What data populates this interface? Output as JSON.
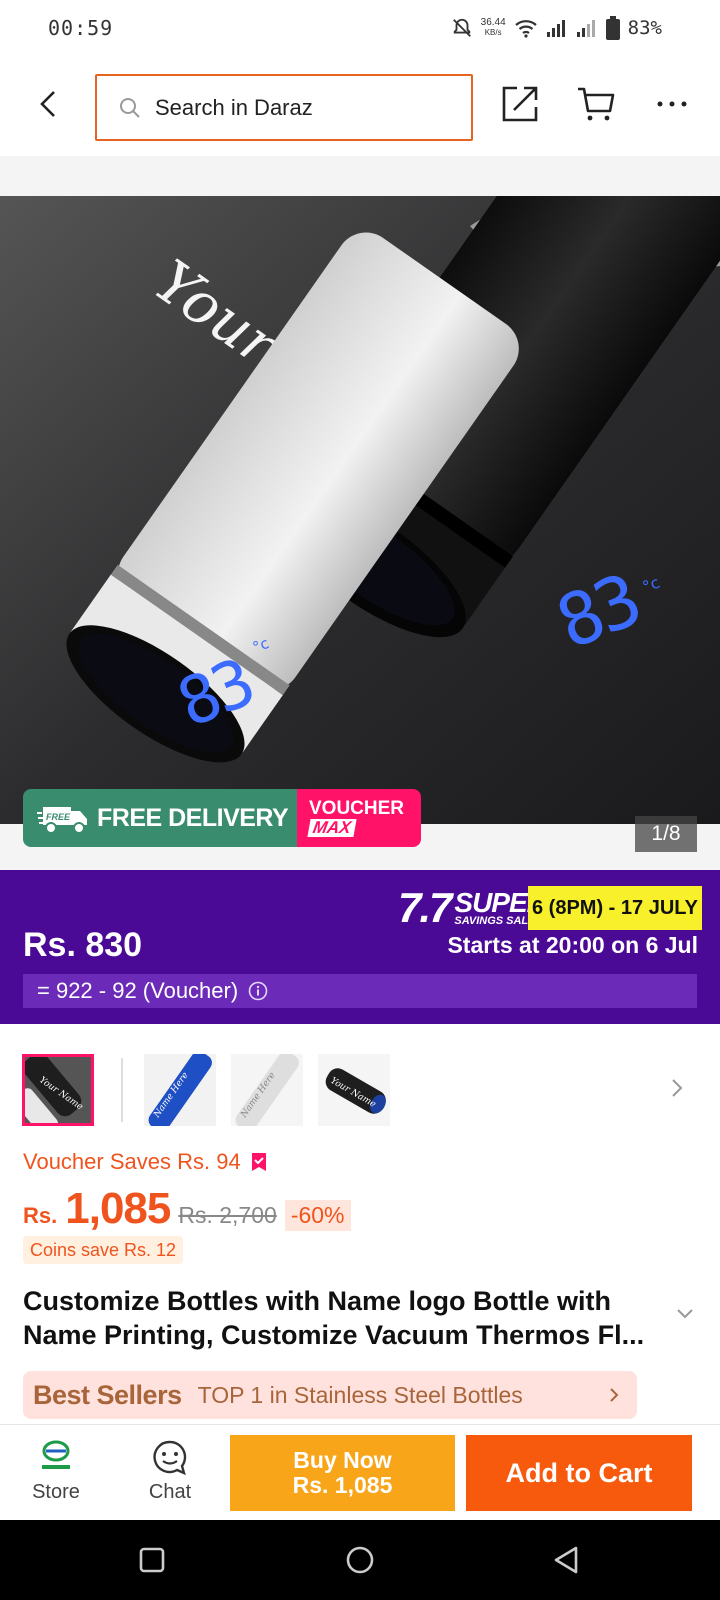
{
  "status_bar": {
    "time": "00:59",
    "net_speed_value": "36.44",
    "net_speed_unit": "KB/s",
    "battery": "83%"
  },
  "header": {
    "search_placeholder": "Search in Daraz",
    "icons": [
      "back-arrow-icon",
      "search-icon",
      "share-icon",
      "cart-icon",
      "more-icon"
    ]
  },
  "product_image": {
    "engraving_text": "Your Name",
    "display_temperature": "83",
    "display_unit": "°c",
    "counter": "1/8"
  },
  "promo_banner": {
    "free_badge": "FREE",
    "free_delivery": "FREE DELIVERY",
    "voucher_top": "VOUCHER",
    "voucher_bottom": "MAX"
  },
  "campaign": {
    "price": "Rs. 830",
    "logo_number": "7.7",
    "logo_super": "SUPER",
    "logo_savings": "SAVINGS SALE",
    "dates": "6 (8PM) - 17 JULY",
    "starts": "Starts at 20:00 on 6 Jul",
    "voucher_calc": "= 922 - 92 (Voucher)"
  },
  "thumbnails": {
    "items": [
      {
        "label": "Your Name",
        "color": "#1e1e1e"
      },
      {
        "label": "Name Here",
        "color": "#1f4fc4"
      },
      {
        "label": "Name Here",
        "color": "#e8e8e8"
      },
      {
        "label": "Your Name",
        "color": "#1e1e1e"
      }
    ]
  },
  "pricing": {
    "voucher_saves": "Voucher Saves Rs. 94",
    "currency": "Rs.",
    "price": "1,085",
    "old_price": "Rs. 2,700",
    "discount": "-60%",
    "coins": "Coins save Rs. 12"
  },
  "product": {
    "title": "Customize Bottles with Name logo Bottle with Name Printing, Customize Vacuum Thermos Fl..."
  },
  "best_seller": {
    "title": "Best Sellers",
    "text": "TOP 1 in Stainless Steel Bottles"
  },
  "action_bar": {
    "store_label": "Store",
    "chat_label": "Chat",
    "buy_now_line1": "Buy Now",
    "buy_now_line2": "Rs. 1,085",
    "add_to_cart": "Add to Cart"
  },
  "colors": {
    "accent_orange": "#f85a0d",
    "buy_now": "#f9a51a",
    "campaign_purple": "#4b0a96",
    "campaign_yellow": "#f7f02a",
    "voucher_pink": "#ff1268",
    "delivery_green": "#3a8c6e"
  }
}
